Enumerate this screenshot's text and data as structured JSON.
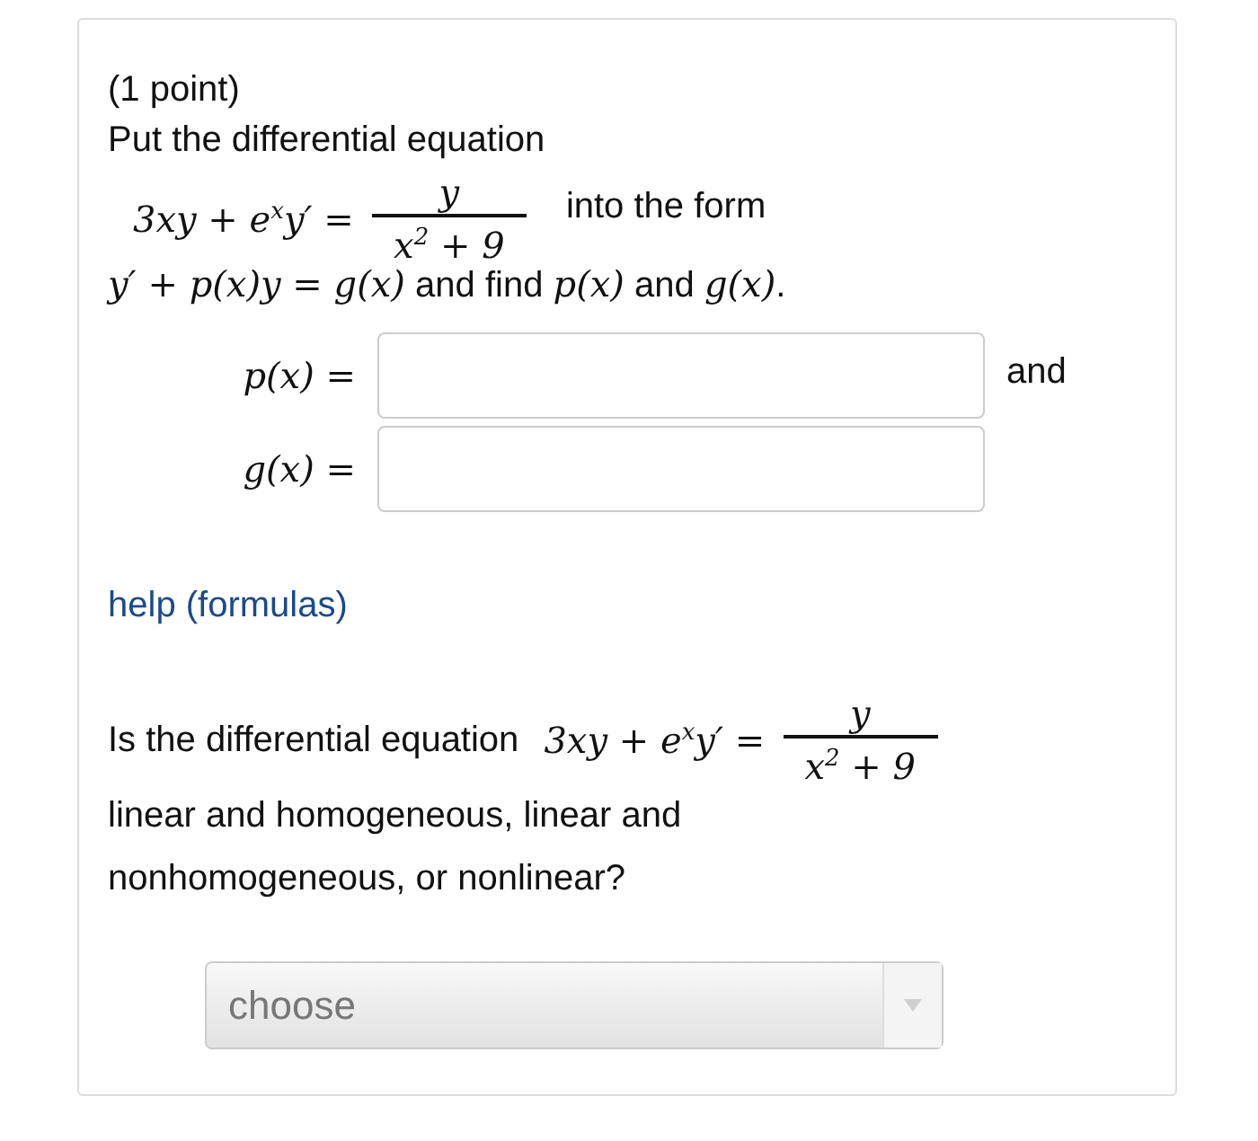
{
  "points": "(1 point)",
  "intro": "Put the differential equation",
  "equation": {
    "lhs": "3xy + e$^{x}$y′ =",
    "numerator": "y",
    "denominator": "x$^{2}$ + 9"
  },
  "form_text": "into the form",
  "sentence": [
    {
      "kind": "math",
      "text": "y′ + p(x)y = g(x)"
    },
    {
      "kind": "text",
      "text": " and find "
    },
    {
      "kind": "math",
      "text": "p(x)"
    },
    {
      "kind": "text",
      "text": " and "
    },
    {
      "kind": "math",
      "text": "g(x)"
    },
    {
      "kind": "text",
      "text": "."
    }
  ],
  "answers": [
    {
      "label": "p(x) =",
      "trailing": "and"
    },
    {
      "label": "g(x) ="
    }
  ],
  "help_link": "help (formulas)",
  "question": {
    "text": "Is the differential equation",
    "equation": {
      "lhs": "3xy + e$^{x}$y′ =",
      "numerator": "y",
      "denominator": "x$^{2}$ + 9"
    },
    "continuation": "linear and homogeneous, linear and nonhomogeneous, or nonlinear?"
  },
  "select": {
    "value": "choose"
  }
}
